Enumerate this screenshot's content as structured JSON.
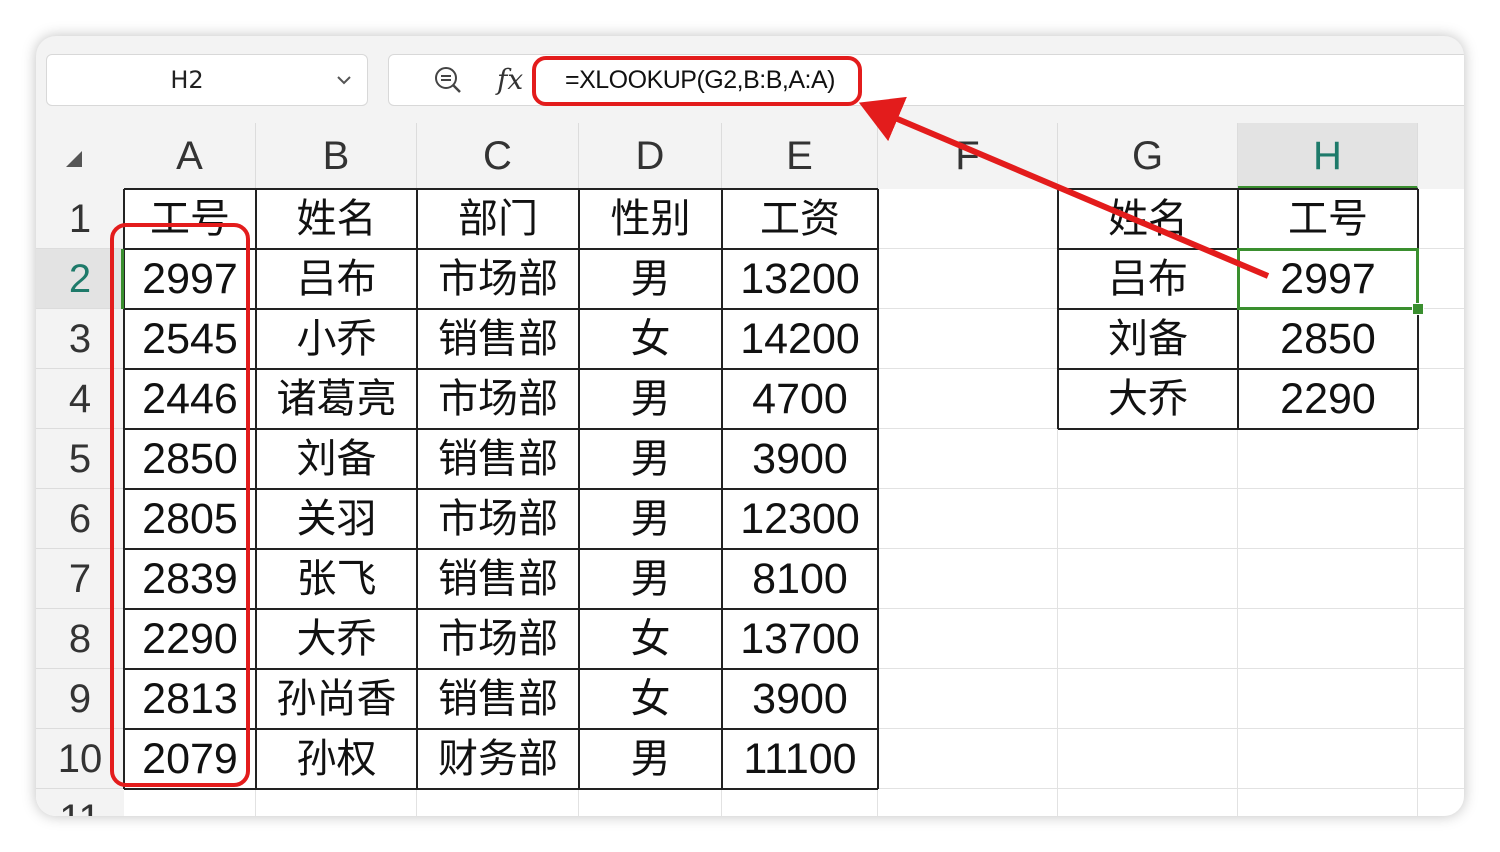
{
  "name_box": {
    "value": "H2"
  },
  "formula_bar": {
    "fx_label": "fx",
    "formula": "=XLOOKUP(G2,B:B,A:A)"
  },
  "columns": [
    "A",
    "B",
    "C",
    "D",
    "E",
    "F",
    "G",
    "H"
  ],
  "rows": [
    "1",
    "2",
    "3",
    "4",
    "5",
    "6",
    "7",
    "8",
    "9",
    "10",
    "11"
  ],
  "selected_cell": "H2",
  "main_table": {
    "headers": [
      "工号",
      "姓名",
      "部门",
      "性别",
      "工资"
    ],
    "rows": [
      [
        "2997",
        "吕布",
        "市场部",
        "男",
        "13200"
      ],
      [
        "2545",
        "小乔",
        "销售部",
        "女",
        "14200"
      ],
      [
        "2446",
        "诸葛亮",
        "市场部",
        "男",
        "4700"
      ],
      [
        "2850",
        "刘备",
        "销售部",
        "男",
        "3900"
      ],
      [
        "2805",
        "关羽",
        "市场部",
        "男",
        "12300"
      ],
      [
        "2839",
        "张飞",
        "销售部",
        "男",
        "8100"
      ],
      [
        "2290",
        "大乔",
        "市场部",
        "女",
        "13700"
      ],
      [
        "2813",
        "孙尚香",
        "销售部",
        "女",
        "3900"
      ],
      [
        "2079",
        "孙权",
        "财务部",
        "男",
        "11100"
      ]
    ]
  },
  "lookup_table": {
    "headers": [
      "姓名",
      "工号"
    ],
    "rows": [
      [
        "吕布",
        "2997"
      ],
      [
        "刘备",
        "2850"
      ],
      [
        "大乔",
        "2290"
      ]
    ]
  },
  "colors": {
    "annotation": "#e31c1c",
    "selection": "#3a8f2f",
    "header_selected_text": "#1e7a6a"
  },
  "icons": [
    "chevron-down-icon",
    "zoom-icon",
    "fx-icon",
    "select-all-icon"
  ]
}
